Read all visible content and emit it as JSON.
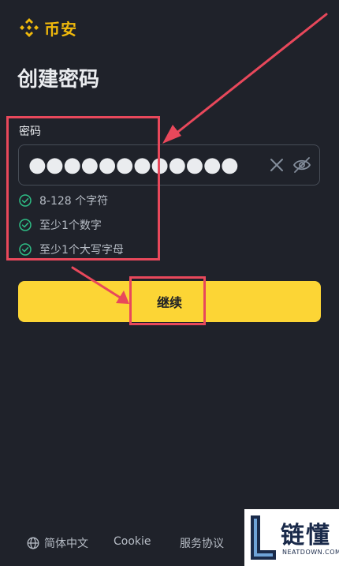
{
  "header": {
    "logo_text": "币安"
  },
  "page": {
    "title": "创建密码"
  },
  "password": {
    "label": "密码",
    "value": "●●●●●●●●●●●●"
  },
  "rules": [
    {
      "text": "8-128 个字符",
      "status": "met"
    },
    {
      "text": "至少1个数字",
      "status": "met"
    },
    {
      "text": "至少1个大写字母",
      "status": "met"
    }
  ],
  "actions": {
    "continue_label": "继续"
  },
  "footer": {
    "language": "简体中文",
    "cookie": "Cookie",
    "terms": "服务协议"
  },
  "watermark": {
    "cn": "链懂",
    "en": "NEATDOWN.COM"
  },
  "colors": {
    "background": "#1f222a",
    "brand": "#f0b90b",
    "button": "#fcd535",
    "check": "#2ebd85",
    "annotation": "#e8485b"
  }
}
